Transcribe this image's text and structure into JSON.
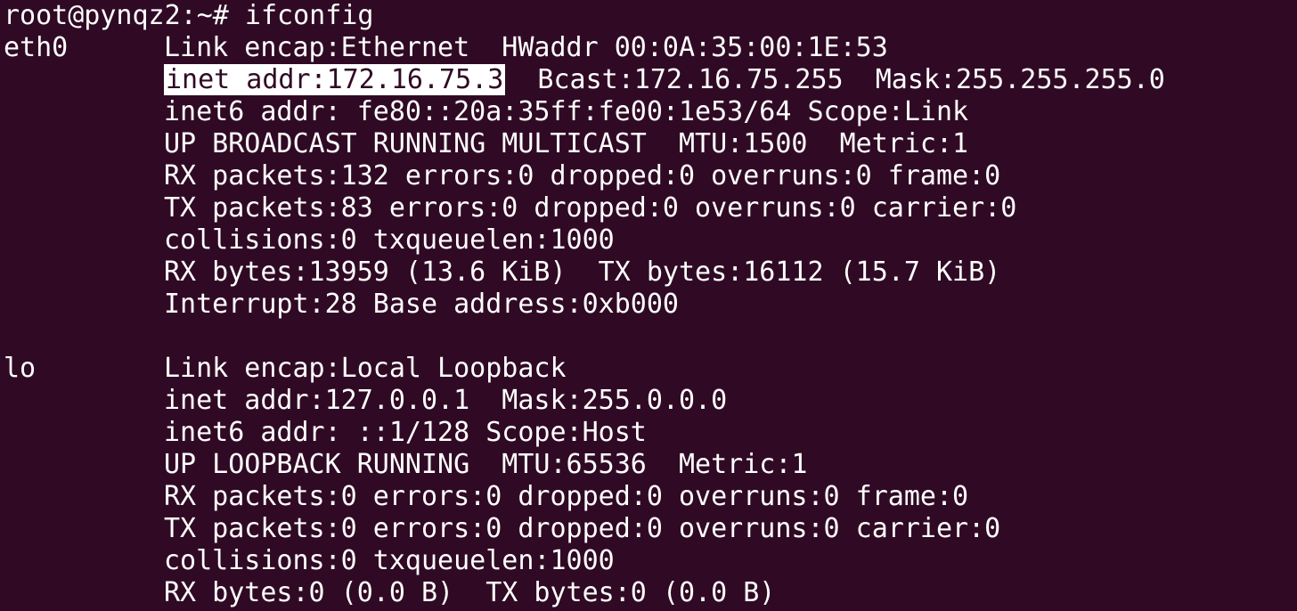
{
  "colors": {
    "background": "#300a24",
    "foreground": "#ffffff",
    "highlight_bg": "#ffffff",
    "highlight_fg": "#300a24"
  },
  "prompt": {
    "text": "root@pynqz2:~# ifconfig"
  },
  "eth0": {
    "name": "eth0",
    "link": "Link encap:Ethernet  HWaddr 00:0A:35:00:1E:53",
    "inet_highlighted": "inet addr:172.16.75.3",
    "inet_rest": "  Bcast:172.16.75.255  Mask:255.255.255.0",
    "inet6": "inet6 addr: fe80::20a:35ff:fe00:1e53/64 Scope:Link",
    "flags": "UP BROADCAST RUNNING MULTICAST  MTU:1500  Metric:1",
    "rx_packets": "RX packets:132 errors:0 dropped:0 overruns:0 frame:0",
    "tx_packets": "TX packets:83 errors:0 dropped:0 overruns:0 carrier:0",
    "collisions": "collisions:0 txqueuelen:1000",
    "bytes": "RX bytes:13959 (13.6 KiB)  TX bytes:16112 (15.7 KiB)",
    "interrupt": "Interrupt:28 Base address:0xb000"
  },
  "lo": {
    "name": "lo",
    "link": "Link encap:Local Loopback",
    "inet": "inet addr:127.0.0.1  Mask:255.0.0.0",
    "inet6": "inet6 addr: ::1/128 Scope:Host",
    "flags": "UP LOOPBACK RUNNING  MTU:65536  Metric:1",
    "rx_packets": "RX packets:0 errors:0 dropped:0 overruns:0 frame:0",
    "tx_packets": "TX packets:0 errors:0 dropped:0 overruns:0 carrier:0",
    "collisions": "collisions:0 txqueuelen:1000",
    "bytes": "RX bytes:0 (0.0 B)  TX bytes:0 (0.0 B)"
  }
}
